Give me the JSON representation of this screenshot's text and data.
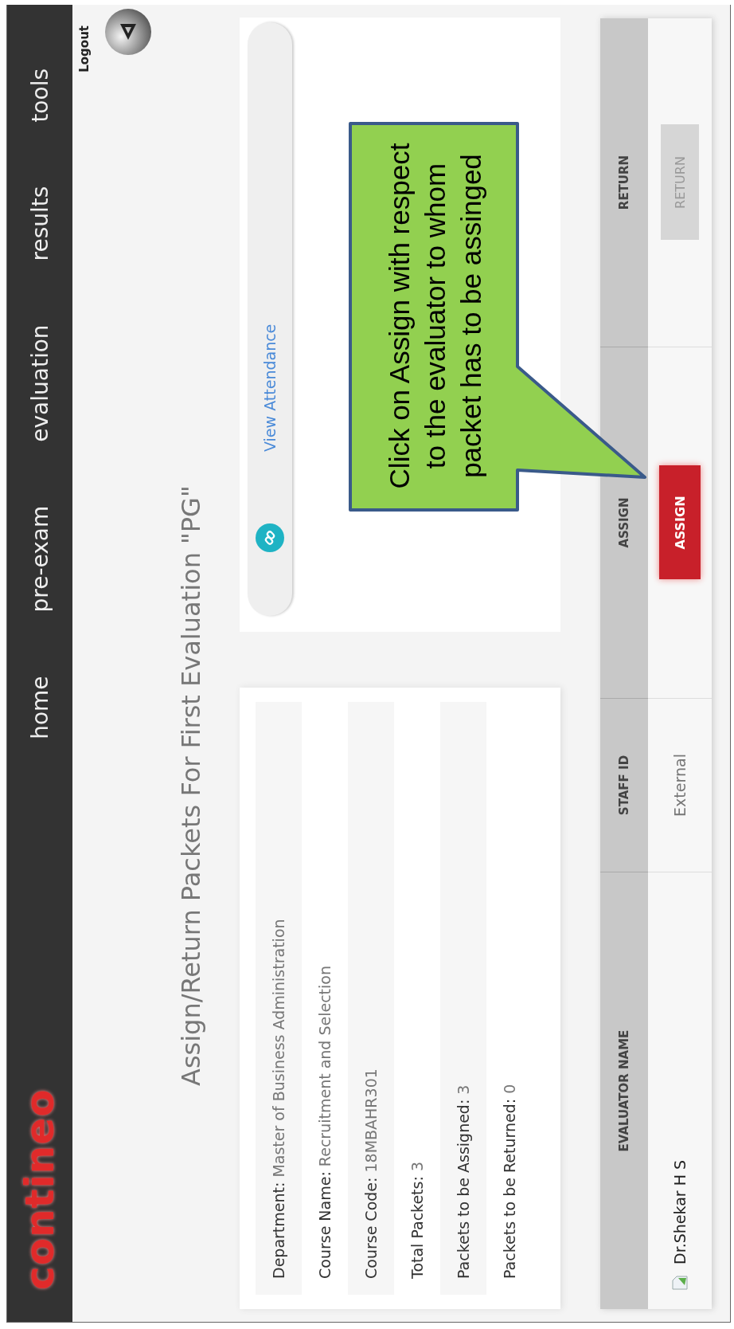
{
  "logo": "contineo",
  "nav": [
    {
      "label": "home"
    },
    {
      "label": "pre-exam"
    },
    {
      "label": "evaluation"
    },
    {
      "label": "results"
    },
    {
      "label": "tools"
    }
  ],
  "logout": "Logout",
  "title": "Assign/Return Packets For First Evaluation \"PG\"",
  "info": [
    {
      "label": "Department:",
      "value": "Master of Business Administration"
    },
    {
      "label": "Course Name:",
      "value": "Recruitment and Selection"
    },
    {
      "label": "Course Code:",
      "value": "18MBAHR301"
    },
    {
      "label": "Total Packets:",
      "value": "3"
    },
    {
      "label": "Packets to be Assigned:",
      "value": "3"
    },
    {
      "label": "Packets to be Returned:",
      "value": "0"
    }
  ],
  "attendance_link": "View Attendance",
  "table": {
    "columns": [
      "EVALUATOR NAME",
      "STAFF ID",
      "ASSIGN",
      "RETURN"
    ],
    "rows": [
      {
        "evaluator_name": "Dr.Shekar H S",
        "staff_id": "External",
        "assign": "ASSIGN",
        "return": {
          "label": "RETURN",
          "disabled": true
        }
      }
    ]
  },
  "callout": {
    "text": "Click on Assign  with respect to the evaluator to whom packet has to be assinged"
  }
}
